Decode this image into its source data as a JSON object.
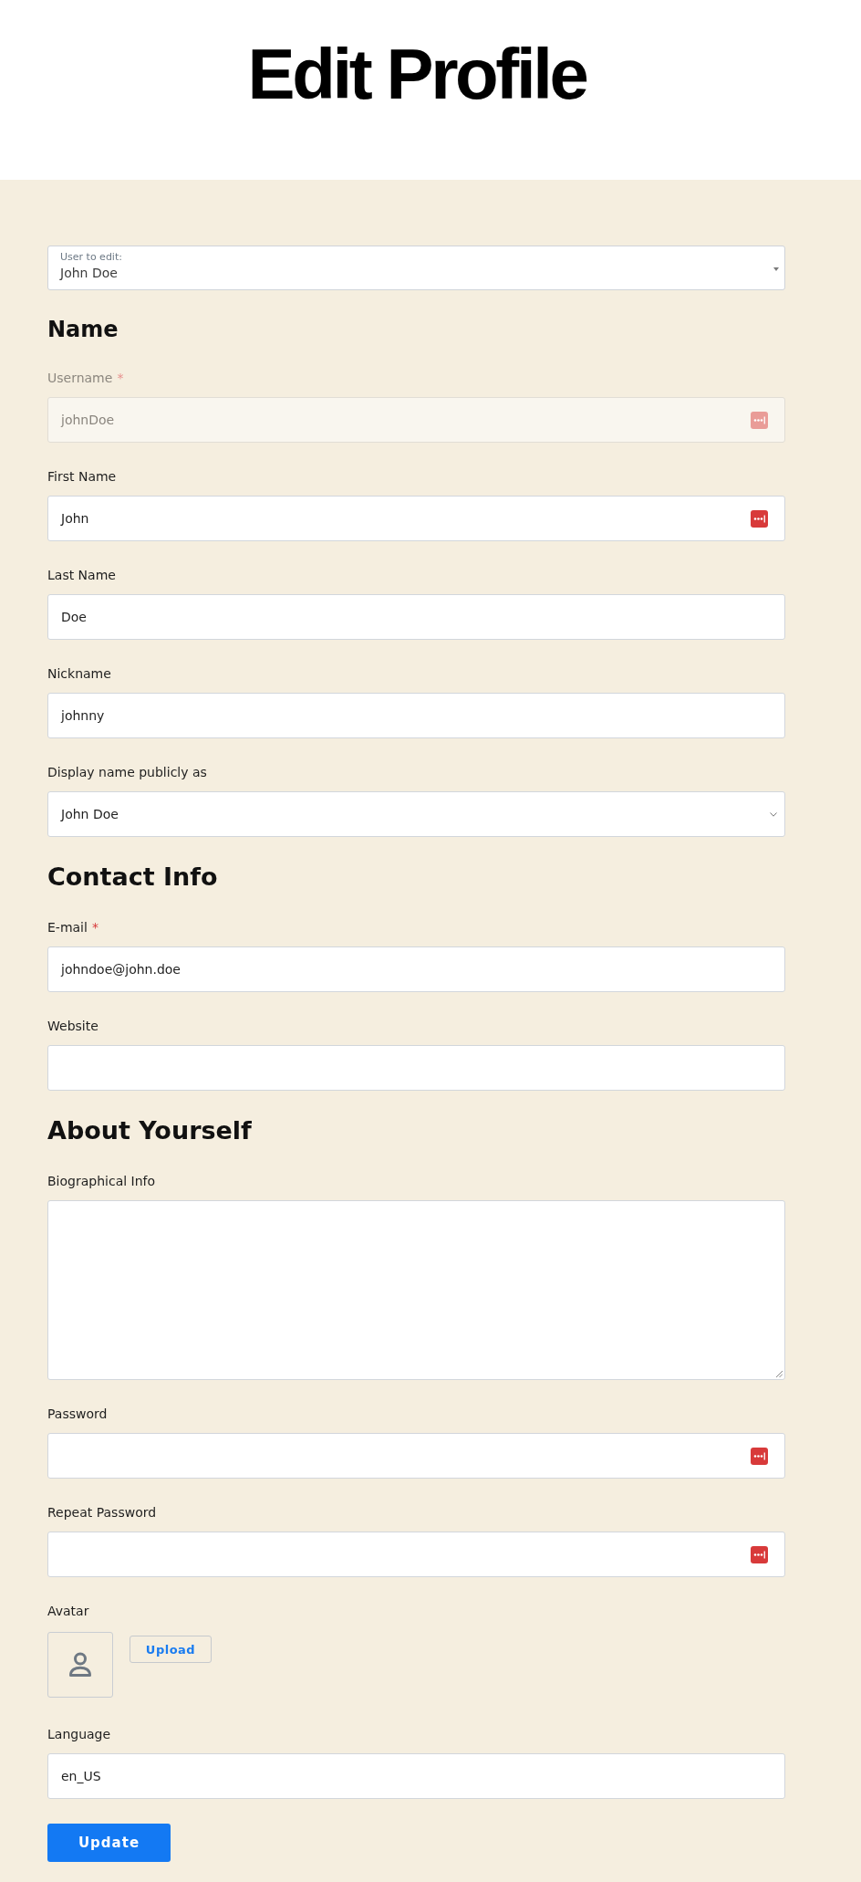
{
  "header": {
    "title": "Edit Profile"
  },
  "user_select": {
    "label": "User to edit:",
    "value": "John Doe"
  },
  "sections": [
    {
      "heading": "Name",
      "fields": [
        {
          "kind": "text",
          "label": "Username",
          "required_mark": "*",
          "disabled": true,
          "value": "johnDoe",
          "dots_icon": true
        },
        {
          "kind": "text",
          "label": "First Name",
          "disabled": false,
          "value": "John",
          "dots_icon": true
        },
        {
          "kind": "text",
          "label": "Last Name",
          "disabled": false,
          "value": "Doe",
          "dots_icon": false
        },
        {
          "kind": "text",
          "label": "Nickname",
          "disabled": false,
          "value": "johnny",
          "dots_icon": false
        },
        {
          "kind": "select",
          "label": "Display name publicly as",
          "disabled": false,
          "value": "John Doe",
          "dots_icon": false
        }
      ]
    },
    {
      "heading": "Contact Info",
      "fields": [
        {
          "kind": "text",
          "label": "E-mail",
          "required_mark": "*",
          "disabled": false,
          "value": "johndoe@john.doe",
          "dots_icon": false
        },
        {
          "kind": "text",
          "label": "Website",
          "disabled": false,
          "dots_icon": false
        }
      ]
    },
    {
      "heading": "About Yourself",
      "fields": [
        {
          "kind": "textarea",
          "label": "Biographical Info",
          "disabled": false,
          "dots_icon": false
        },
        {
          "kind": "text",
          "label": "Password",
          "disabled": false,
          "dots_icon": true
        },
        {
          "kind": "text",
          "label": "Repeat Password",
          "disabled": false,
          "dots_icon": true
        },
        {
          "kind": "avatar",
          "label": "Avatar",
          "disabled": false,
          "button": "Upload"
        },
        {
          "kind": "text",
          "label": "Language",
          "disabled": false,
          "value": "en_US",
          "dots_icon": false
        }
      ]
    }
  ],
  "submit": {
    "label": "Update"
  }
}
